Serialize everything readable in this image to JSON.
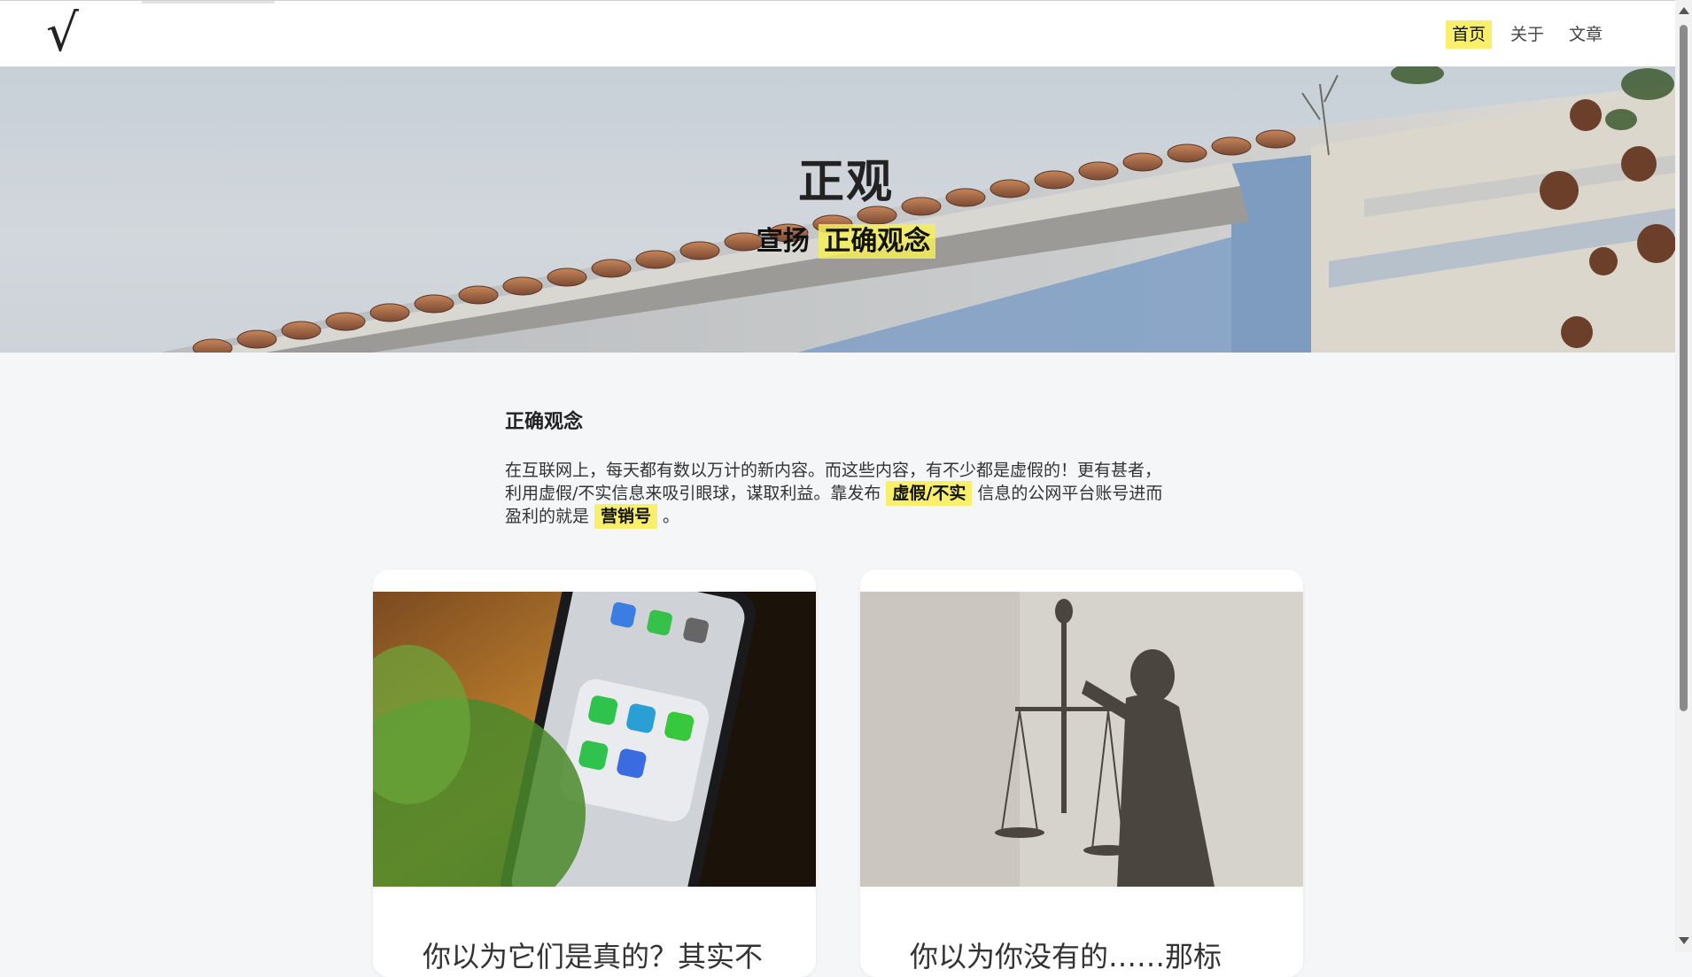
{
  "header": {
    "logo": "√",
    "nav": [
      {
        "label": "首页",
        "active": true
      },
      {
        "label": "关于",
        "active": false
      },
      {
        "label": "文章",
        "active": false
      }
    ]
  },
  "hero": {
    "title": "正观",
    "subtitle_prefix": "宣扬",
    "subtitle_highlight": "正确观念"
  },
  "intro": {
    "heading": "正确观念",
    "text_part1": "在互联网上，每天都有数以万计的新内容。而这些内容，有不少都是虚假的！更有甚者，利用虚假/不实信息来吸引眼球，谋取利益。靠发布",
    "highlight1": "虚假/不实",
    "text_part2": "信息的公网平台账号进而盈利的就是",
    "highlight2": "营销号",
    "text_part3": "。"
  },
  "cards": [
    {
      "title": "你以为它们是真的？其实不",
      "image": "phone-messaging-apps"
    },
    {
      "title": "你以为你没有的……那标",
      "image": "lady-justice-statue"
    }
  ],
  "colors": {
    "highlight": "#f8ef6c",
    "background": "#f5f6f8"
  }
}
